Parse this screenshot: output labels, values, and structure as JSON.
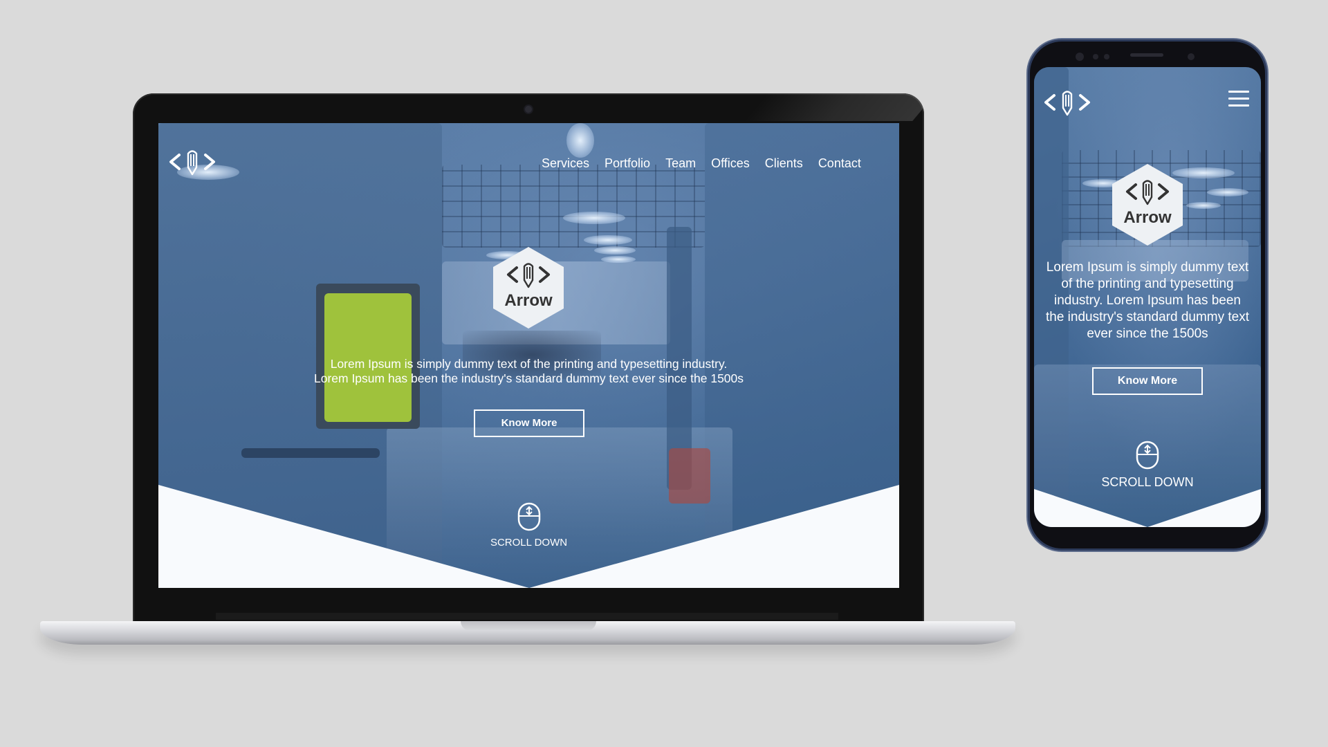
{
  "site": {
    "brand_name": "Arrow",
    "nav": [
      "Services",
      "Portfolio",
      "Team",
      "Offices",
      "Clients",
      "Contact"
    ],
    "desktop_description_line1": "Lorem Ipsum is simply dummy text of the printing and typesetting industry.",
    "desktop_description_line2": "Lorem Ipsum has been the industry's standard dummy text ever since the 1500s",
    "mobile_description": "Lorem Ipsum is simply dummy text of the printing and typesetting industry. Lorem Ipsum has been the industry's standard dummy text ever since the 1500s",
    "cta_label": "Know More",
    "scroll_label": "SCROLL DOWN"
  },
  "icons": {
    "logo": "code-pencil-logo-icon",
    "scroll": "mouse-scroll-icon",
    "menu": "hamburger-menu-icon"
  },
  "colors": {
    "background": "#dadada",
    "site_overlay": "#4a6f9b",
    "white_section": "#f8fafd",
    "hex_badge": "#eef1f4",
    "hex_text": "#333333"
  }
}
